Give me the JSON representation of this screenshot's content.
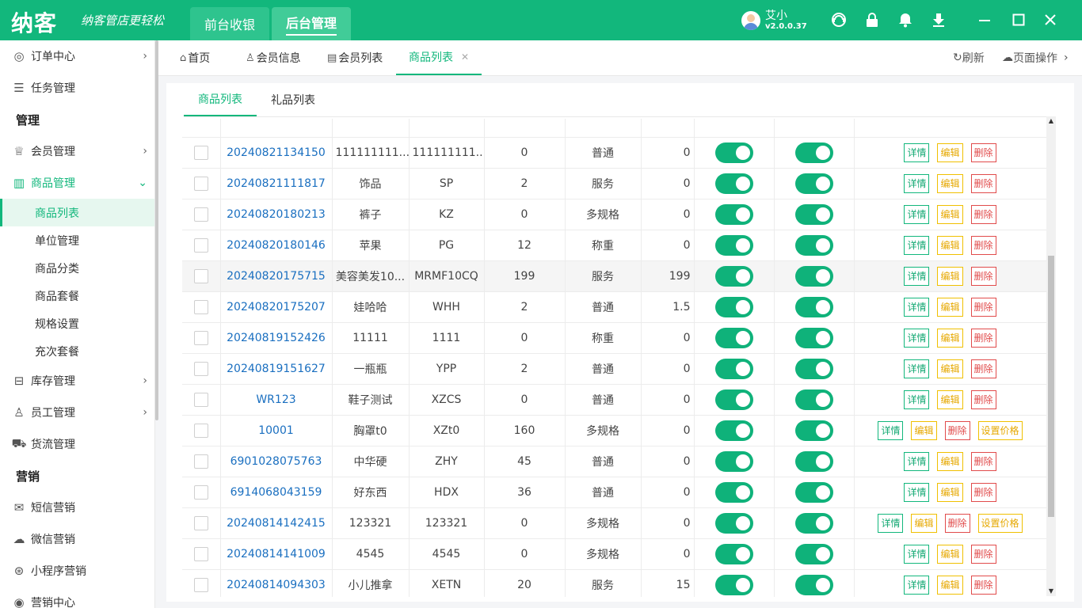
{
  "app": {
    "logo": "纳客",
    "slogan": "纳客管店更轻松",
    "top_tabs": [
      "前台收银",
      "后台管理"
    ],
    "user_name": "艾小",
    "version": "v2.0.0.37"
  },
  "sidebar": {
    "order_center": "订单中心",
    "task_manage": "任务管理",
    "section_manage": "管理",
    "member_manage": "会员管理",
    "goods_manage": "商品管理",
    "goods_sub": [
      "商品列表",
      "单位管理",
      "商品分类",
      "商品套餐",
      "规格设置",
      "充次套餐"
    ],
    "stock_manage": "库存管理",
    "staff_manage": "员工管理",
    "logistics_manage": "货流管理",
    "section_marketing": "营销",
    "sms_marketing": "短信营销",
    "wechat_marketing": "微信营销",
    "mini_marketing": "小程序营销",
    "marketing_center": "营销中心"
  },
  "tabs": {
    "home": "首页",
    "member_info": "会员信息",
    "member_list": "会员列表",
    "goods_list": "商品列表",
    "refresh": "刷新",
    "page_ops": "页面操作"
  },
  "subtabs": [
    "商品列表",
    "礼品列表"
  ],
  "buttons": {
    "detail": "详情",
    "edit": "编辑",
    "delete": "删除",
    "set_price": "设置价格"
  },
  "rows": [
    {
      "code": "20240821134150",
      "name": "111111111...",
      "abbr": "111111111...",
      "stock": "0",
      "type": "普通",
      "price": "0",
      "set_price": false
    },
    {
      "code": "20240821111817",
      "name": "饰品",
      "abbr": "SP",
      "stock": "2",
      "type": "服务",
      "price": "0",
      "set_price": false
    },
    {
      "code": "20240820180213",
      "name": "裤子",
      "abbr": "KZ",
      "stock": "0",
      "type": "多规格",
      "price": "0",
      "set_price": false
    },
    {
      "code": "20240820180146",
      "name": "苹果",
      "abbr": "PG",
      "stock": "12",
      "type": "称重",
      "price": "0",
      "set_price": false
    },
    {
      "code": "20240820175715",
      "name": "美容美发10...",
      "abbr": "MRMF10CQ",
      "stock": "199",
      "type": "服务",
      "price": "199",
      "set_price": false
    },
    {
      "code": "20240820175207",
      "name": "娃哈哈",
      "abbr": "WHH",
      "stock": "2",
      "type": "普通",
      "price": "1.5",
      "set_price": false
    },
    {
      "code": "20240819152426",
      "name": "11111",
      "abbr": "1111",
      "stock": "0",
      "type": "称重",
      "price": "0",
      "set_price": false
    },
    {
      "code": "20240819151627",
      "name": "一瓶瓶",
      "abbr": "YPP",
      "stock": "2",
      "type": "普通",
      "price": "0",
      "set_price": false
    },
    {
      "code": "WR123",
      "name": "鞋子测试",
      "abbr": "XZCS",
      "stock": "0",
      "type": "普通",
      "price": "0",
      "set_price": false
    },
    {
      "code": "10001",
      "name": "胸罩t0",
      "abbr": "XZt0",
      "stock": "160",
      "type": "多规格",
      "price": "0",
      "set_price": true
    },
    {
      "code": "6901028075763",
      "name": "中华硬",
      "abbr": "ZHY",
      "stock": "45",
      "type": "普通",
      "price": "0",
      "set_price": false
    },
    {
      "code": "6914068043159",
      "name": "好东西",
      "abbr": "HDX",
      "stock": "36",
      "type": "普通",
      "price": "0",
      "set_price": false
    },
    {
      "code": "20240814142415",
      "name": "123321",
      "abbr": "123321",
      "stock": "0",
      "type": "多规格",
      "price": "0",
      "set_price": true
    },
    {
      "code": "20240814141009",
      "name": "4545",
      "abbr": "4545",
      "stock": "0",
      "type": "多规格",
      "price": "0",
      "set_price": false
    },
    {
      "code": "20240814094303",
      "name": "小儿推拿",
      "abbr": "XETN",
      "stock": "20",
      "type": "服务",
      "price": "15",
      "set_price": false
    }
  ],
  "colors": {
    "brand": "#12b77c",
    "edit": "#f0c000",
    "delete": "#e14b4b",
    "link": "#1a6fc0"
  }
}
